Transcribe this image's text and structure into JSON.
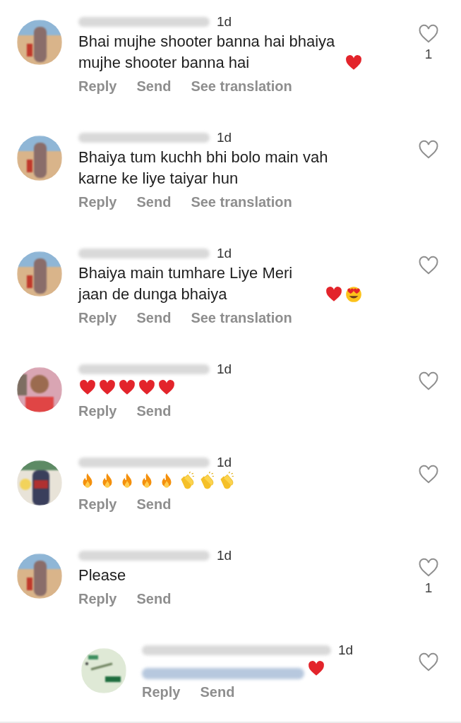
{
  "comments": [
    {
      "kind": "comment",
      "time": "1d",
      "text": "Bhai mujhe shooter banna hai bhaiya mujhe shooter banna hai",
      "emoji": [
        {
          "kind": "heart"
        }
      ],
      "mention": false,
      "likes": "1",
      "actions": [
        "Reply",
        "Send",
        "See translation"
      ]
    },
    {
      "kind": "comment",
      "time": "1d",
      "text": "Bhaiya tum kuchh bhi bolo main vah karne ke liye taiyar hun",
      "mention": false,
      "actions": [
        "Reply",
        "Send",
        "See translation"
      ]
    },
    {
      "kind": "comment",
      "time": "1d",
      "text": "Bhaiya main tumhare Liye Meri jaan de dunga bhaiya",
      "emoji": [
        {
          "kind": "heart"
        },
        {
          "kind": "heart_eyes"
        }
      ],
      "mention": false,
      "actions": [
        "Reply",
        "Send",
        "See translation"
      ]
    },
    {
      "kind": "comment",
      "time": "1d",
      "emoji": [
        {
          "kind": "heart"
        },
        {
          "kind": "heart"
        },
        {
          "kind": "heart"
        },
        {
          "kind": "heart"
        },
        {
          "kind": "heart"
        }
      ],
      "mention": false,
      "actions": [
        "Reply",
        "Send"
      ]
    },
    {
      "kind": "comment",
      "time": "1d",
      "emoji": [
        {
          "kind": "fire"
        },
        {
          "kind": "fire"
        },
        {
          "kind": "fire"
        },
        {
          "kind": "fire"
        },
        {
          "kind": "fire"
        },
        {
          "kind": "clap"
        },
        {
          "kind": "clap"
        },
        {
          "kind": "clap"
        }
      ],
      "mention": false,
      "actions": [
        "Reply",
        "Send"
      ]
    },
    {
      "kind": "comment",
      "time": "1d",
      "text": "Please",
      "mention": false,
      "likes": "1",
      "actions": [
        "Reply",
        "Send"
      ]
    },
    {
      "kind": "reply",
      "time": "1d",
      "emoji": [
        {
          "kind": "heart"
        }
      ],
      "mention": true,
      "actions": [
        "Reply",
        "Send"
      ]
    }
  ]
}
